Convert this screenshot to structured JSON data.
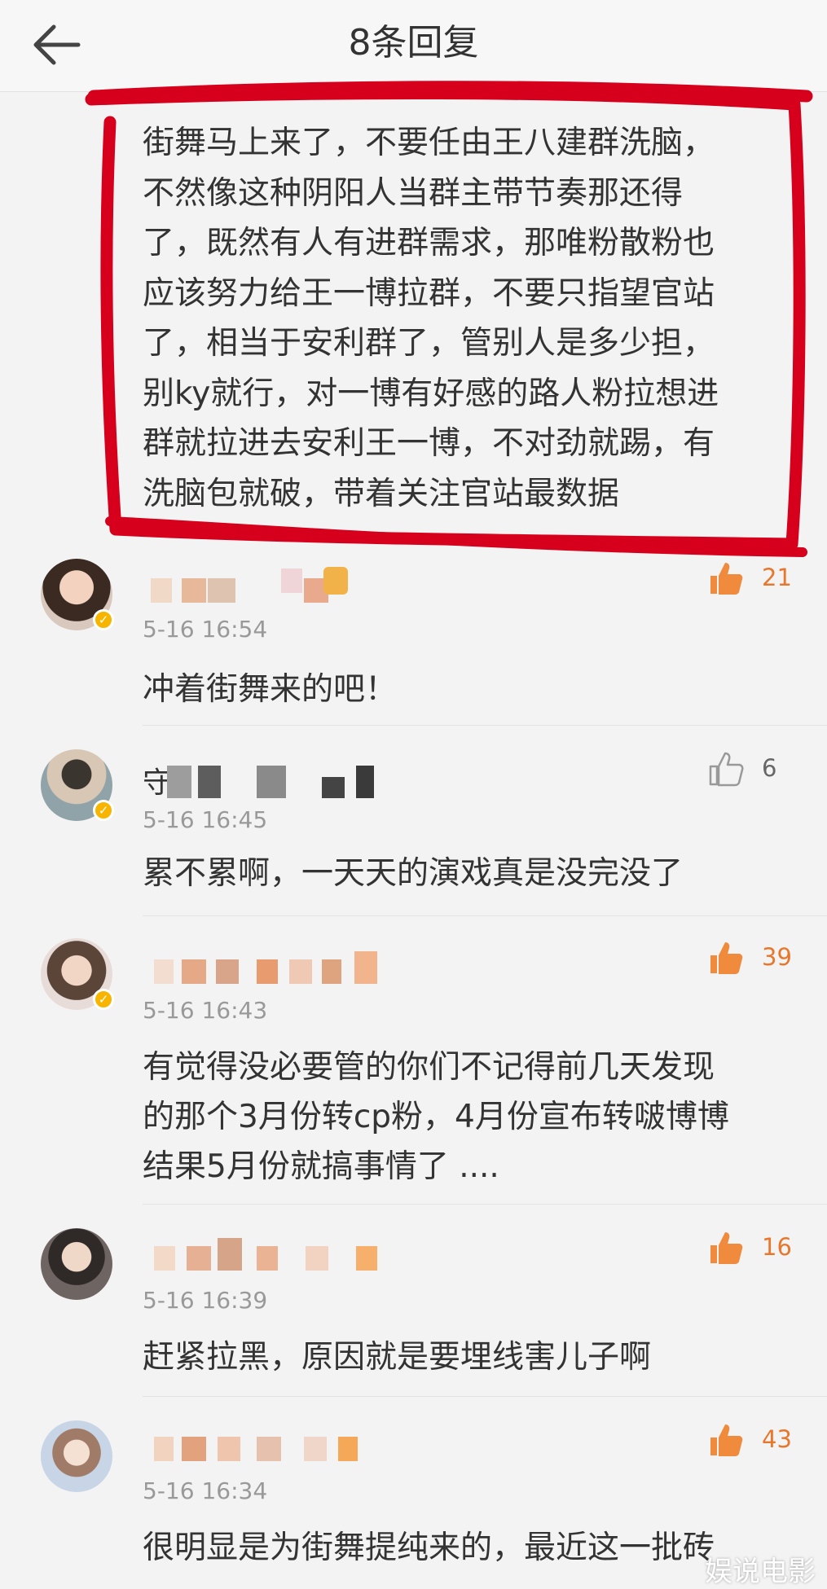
{
  "header": {
    "title": "8条回复"
  },
  "main_post": {
    "text": "街舞马上来了，不要任由王八建群洗脑，\n不然像这种阴阳人当群主带节奏那还得\n了，既然有人有进群需求，那唯粉散粉也\n应该努力给王一博拉群，不要只指望官站\n了，相当于安利群了，管别人是多少担，\n别ky就行，对一博有好感的路人粉拉想进\n群就拉进去安利王一博，不对劲就踢，有\n洗脑包就破，带着关注官站最数据"
  },
  "comments": [
    {
      "time": "5-16 16:54",
      "likes": "21",
      "liked": true,
      "text": "冲着街舞来的吧！"
    },
    {
      "time": "5-16 16:45",
      "likes": "6",
      "liked": false,
      "text": "累不累啊，一天天的演戏真是没完没了",
      "name_visible": "守"
    },
    {
      "time": "5-16 16:43",
      "likes": "39",
      "liked": true,
      "text": "有觉得没必要管的你们不记得前几天发现\n的那个3月份转cp粉，4月份宣布转啵博博\n结果5月份就搞事情了 ...."
    },
    {
      "time": "5-16 16:39",
      "likes": "16",
      "liked": true,
      "text": "赶紧拉黑，原因就是要埋线害儿子啊"
    },
    {
      "time": "5-16 16:34",
      "likes": "43",
      "liked": true,
      "text": "很明显是为街舞提纯来的，最近这一批砖"
    }
  ],
  "watermark": "娱说电影",
  "colors": {
    "accent_orange": "#e8772e",
    "annotation_red": "#d6001c",
    "verified_gold": "#f7b500"
  },
  "icons": {
    "back": "arrow-left-icon",
    "like": "thumbs-up-icon",
    "verified": "verified-badge-icon"
  }
}
